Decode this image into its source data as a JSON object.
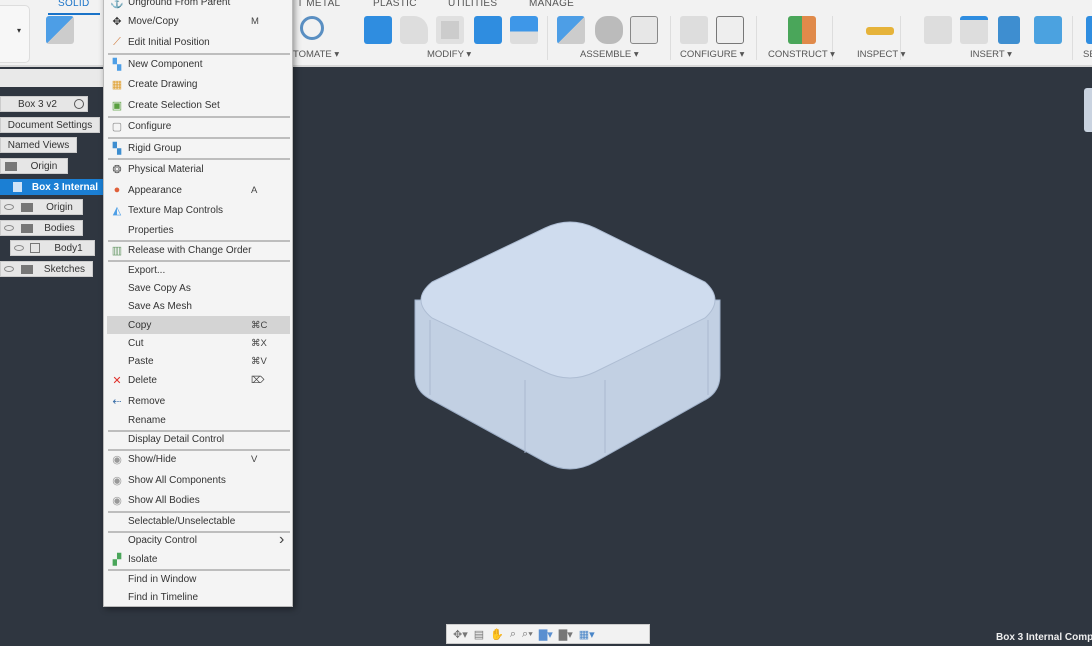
{
  "toolbar": {
    "tabs": [
      "SOLID",
      "T METAL",
      "PLASTIC",
      "UTILITIES",
      "MANAGE"
    ],
    "groups": [
      "TOMATE ▾",
      "MODIFY ▾",
      "ASSEMBLE ▾",
      "CONFIGURE ▾",
      "CONSTRUCT ▾",
      "INSPECT ▾",
      "INSERT ▾",
      "SE"
    ],
    "left_dropdown": "▾"
  },
  "browser": {
    "nodes": [
      "Box 3 v2",
      "Document Settings",
      "Named Views",
      "Origin",
      "Box 3 Internal",
      "Origin",
      "Bodies",
      "Body1",
      "Sketches"
    ]
  },
  "context_menu": {
    "items": [
      {
        "label": "Unground From Parent",
        "icon": "anchor-icon"
      },
      {
        "label": "Move/Copy",
        "icon": "move-icon",
        "shortcut": "M"
      },
      {
        "label": "Edit Initial Position",
        "icon": "edit-position-icon"
      },
      {
        "label": "New Component",
        "icon": "new-component-icon"
      },
      {
        "label": "Create Drawing",
        "icon": "drawing-icon"
      },
      {
        "label": "Create Selection Set",
        "icon": "selection-set-icon"
      },
      {
        "label": "Configure",
        "icon": "configure-icon"
      },
      {
        "label": "Rigid Group",
        "icon": "rigid-group-icon"
      },
      {
        "label": "Physical Material",
        "icon": "material-icon"
      },
      {
        "label": "Appearance",
        "icon": "appearance-icon",
        "shortcut": "A"
      },
      {
        "label": "Texture Map Controls",
        "icon": "texture-icon"
      },
      {
        "label": "Properties"
      },
      {
        "label": "Release with Change Order",
        "icon": "release-icon"
      },
      {
        "label": "Export..."
      },
      {
        "label": "Save Copy As"
      },
      {
        "label": "Save As Mesh"
      },
      {
        "label": "Copy",
        "shortcut": "⌘C"
      },
      {
        "label": "Cut",
        "shortcut": "⌘X"
      },
      {
        "label": "Paste",
        "shortcut": "⌘V"
      },
      {
        "label": "Delete",
        "icon": "delete-icon",
        "shortcut": "⌦"
      },
      {
        "label": "Remove",
        "icon": "remove-icon"
      },
      {
        "label": "Rename"
      },
      {
        "label": "Display Detail Control"
      },
      {
        "label": "Show/Hide",
        "icon": "eye-icon",
        "shortcut": "V"
      },
      {
        "label": "Show All Components",
        "icon": "eye-icon"
      },
      {
        "label": "Show All Bodies",
        "icon": "eye-icon"
      },
      {
        "label": "Selectable/Unselectable"
      },
      {
        "label": "Opacity Control",
        "submenu": "›"
      },
      {
        "label": "Isolate",
        "icon": "isolate-icon"
      },
      {
        "label": "Find in Window"
      },
      {
        "label": "Find in Timeline"
      }
    ],
    "highlighted": "Copy"
  },
  "status": {
    "text": "Box 3 Internal Comp"
  },
  "colors": {
    "accent": "#1b7fd4",
    "viewport": "#2f3640",
    "model": "#c5d3e6"
  }
}
